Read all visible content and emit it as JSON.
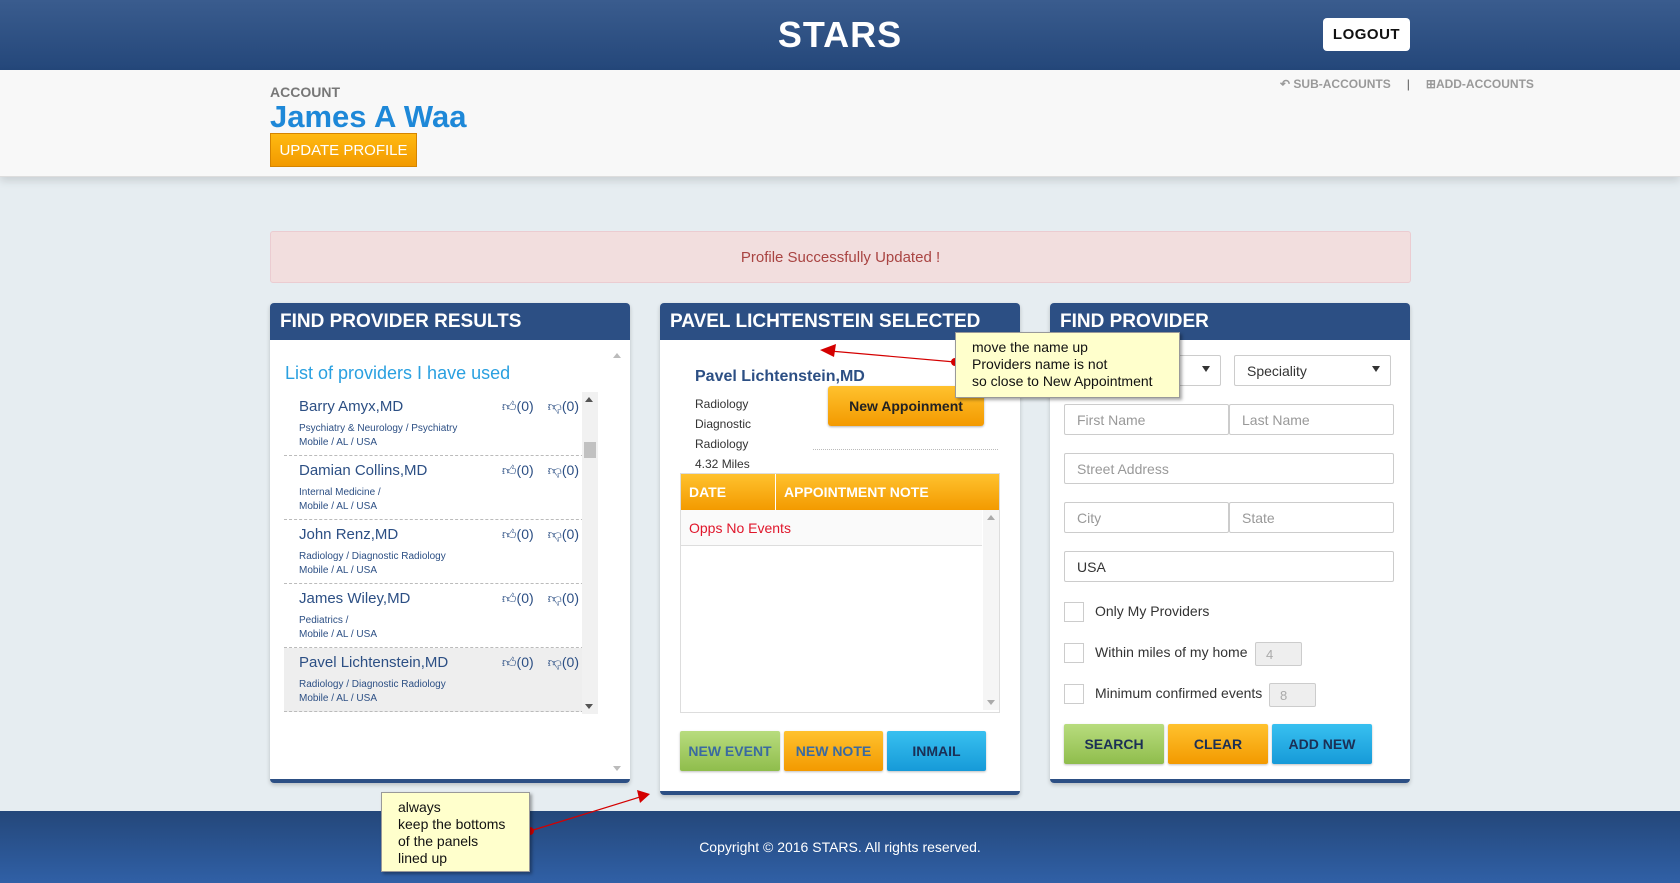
{
  "header": {
    "title": "STARS",
    "logout_label": "LOGOUT"
  },
  "account": {
    "label": "ACCOUNT",
    "name": "James A Waa",
    "update_label": "UPDATE PROFILE",
    "links": [
      {
        "label": "SUB-ACCOUNTS",
        "icon": "reply-icon"
      },
      {
        "label": "ADD-ACCOUNTS",
        "icon": "plus-square-icon"
      }
    ],
    "separator": "|"
  },
  "alert": {
    "message": "Profile Successfully Updated !"
  },
  "results": {
    "title": "FIND PROVIDER RESULTS",
    "list_title": "List of providers I have used",
    "providers": [
      {
        "name": "Barry Amyx,MD",
        "spec": "Psychiatry & Neurology / Psychiatry",
        "loc": "Mobile / AL / USA",
        "up": "(0)",
        "down": "(0)"
      },
      {
        "name": "Damian Collins,MD",
        "spec": "Internal Medicine /",
        "loc": "Mobile / AL / USA",
        "up": "(0)",
        "down": "(0)"
      },
      {
        "name": "John Renz,MD",
        "spec": "Radiology / Diagnostic Radiology",
        "loc": "Mobile / AL / USA",
        "up": "(0)",
        "down": "(0)"
      },
      {
        "name": "James Wiley,MD",
        "spec": "Pediatrics /",
        "loc": "Mobile / AL / USA",
        "up": "(0)",
        "down": "(0)"
      },
      {
        "name": "Pavel Lichtenstein,MD",
        "spec": "Radiology / Diagnostic Radiology",
        "loc": "Mobile / AL / USA",
        "up": "(0)",
        "down": "(0)"
      }
    ]
  },
  "selected": {
    "title": "PAVEL LICHTENSTEIN SELECTED",
    "name": "Pavel Lichtenstein,MD",
    "info": [
      "Radiology",
      "Diagnostic",
      "Radiology",
      "4.32 Miles"
    ],
    "new_appointment": "New Appoinment",
    "table_headers": [
      "DATE",
      "APPOINTMENT NOTE"
    ],
    "empty_message": "Opps No Events",
    "buttons": {
      "new_event": "NEW EVENT",
      "new_note": "NEW NOTE",
      "inmail": "INMAIL"
    }
  },
  "find": {
    "title": "FIND PROVIDER",
    "speciality_value": "Speciality",
    "first_name_placeholder": "First Name",
    "last_name_placeholder": "Last Name",
    "street_placeholder": "Street Address",
    "city_placeholder": "City",
    "state_placeholder": "State",
    "country_value": "USA",
    "only_my_providers": "Only My Providers",
    "within_miles": "Within miles of my home",
    "within_miles_value": "4",
    "min_events": "Minimum confirmed events",
    "min_events_value": "8",
    "search_label": "SEARCH",
    "clear_label": "CLEAR",
    "add_new_label": "ADD NEW"
  },
  "annotations": {
    "note1": [
      "move the name up",
      "Providers name is not",
      "so close to New Appointment"
    ],
    "note2": [
      "always",
      "keep the bottoms",
      "of the panels",
      "lined up"
    ]
  },
  "footer": {
    "copyright": "Copyright © 2016 STARS. All rights reserved."
  }
}
